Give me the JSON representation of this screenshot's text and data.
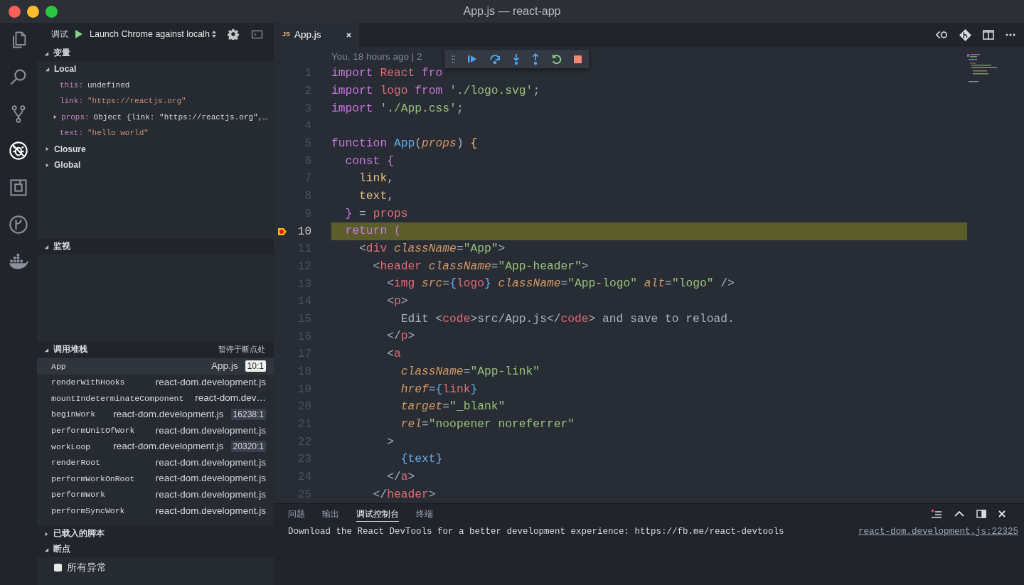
{
  "window": {
    "title": "App.js — react-app"
  },
  "activity_bar": {
    "items": [
      {
        "selected": false
      },
      {
        "selected": false
      },
      {
        "selected": false
      },
      {
        "selected": true
      },
      {
        "selected": false
      },
      {
        "selected": false
      },
      {
        "selected": false
      }
    ]
  },
  "debug_toolbar": {
    "label": "调试",
    "configuration": "Launch Chrome against localh"
  },
  "variables": {
    "title": "变量",
    "expanded": true,
    "scopes": [
      {
        "name": "Local",
        "expanded": true,
        "children": [
          {
            "name": "this:",
            "value": "undefined",
            "kind": "plain"
          },
          {
            "name": "link:",
            "value": "\"https://reactjs.org\"",
            "kind": "string"
          },
          {
            "name": "props:",
            "value": "Object {link: \"https://reactjs.org\",…",
            "kind": "object",
            "expanded": false
          },
          {
            "name": "text:",
            "value": "\"hello world\"",
            "kind": "string"
          }
        ]
      },
      {
        "name": "Closure",
        "expanded": false
      },
      {
        "name": "Global",
        "expanded": false
      }
    ]
  },
  "watch": {
    "title": "监视",
    "expanded": true
  },
  "call_stack": {
    "title": "调用堆栈",
    "expanded": true,
    "status": "暂停于断点处",
    "frames": [
      {
        "name": "App",
        "file": "App.js",
        "line": "10:1",
        "selected": true
      },
      {
        "name": "renderWithHooks",
        "file": "react-dom.development.js",
        "selected": false
      },
      {
        "name": "mountIndeterminateComponent",
        "file": "react-dom.dev…",
        "selected": false
      },
      {
        "name": "beginWork",
        "file": "react-dom.development.js",
        "line": "16238:1",
        "selected": false
      },
      {
        "name": "performUnitOfWork",
        "file": "react-dom.development.js",
        "selected": false
      },
      {
        "name": "workLoop",
        "file": "react-dom.development.js",
        "line": "20320:1",
        "selected": false
      },
      {
        "name": "renderRoot",
        "file": "react-dom.development.js",
        "selected": false
      },
      {
        "name": "performWorkOnRoot",
        "file": "react-dom.development.js",
        "selected": false
      },
      {
        "name": "performWork",
        "file": "react-dom.development.js",
        "selected": false
      },
      {
        "name": "performSyncWork",
        "file": "react-dom.development.js",
        "selected": false
      }
    ]
  },
  "loaded_scripts": {
    "title": "已载入的脚本",
    "expanded": false
  },
  "breakpoints": {
    "title": "断点",
    "expanded": true,
    "items": [
      {
        "label": "所有异常",
        "checked": false
      }
    ]
  },
  "tabs": [
    {
      "icon_label": "JS",
      "label": "App.js",
      "selected": true
    }
  ],
  "blame": "You, 18 hours ago | 2",
  "code": {
    "lines": [
      {
        "number": "1",
        "current": false,
        "breakpoint": false,
        "segments": [
          {
            "kind": "keyword",
            "text": "import "
          },
          {
            "kind": "variable",
            "text": "React "
          },
          {
            "kind": "keyword",
            "text": "fro"
          }
        ]
      },
      {
        "number": "2",
        "current": false,
        "breakpoint": false,
        "segments": [
          {
            "kind": "keyword",
            "text": "import "
          },
          {
            "kind": "variable",
            "text": "logo "
          },
          {
            "kind": "keyword",
            "text": "from "
          },
          {
            "kind": "string",
            "text": "'./logo.svg'"
          },
          {
            "kind": "plain",
            "text": ";"
          }
        ]
      },
      {
        "number": "3",
        "current": false,
        "breakpoint": false,
        "segments": [
          {
            "kind": "keyword",
            "text": "import "
          },
          {
            "kind": "string",
            "text": "'./App.css'"
          },
          {
            "kind": "plain",
            "text": ";"
          }
        ]
      },
      {
        "number": "4",
        "current": false,
        "breakpoint": false
      },
      {
        "number": "5",
        "current": false,
        "breakpoint": false,
        "segments": [
          {
            "kind": "keyword",
            "text": "function "
          },
          {
            "kind": "function",
            "text": "App"
          },
          {
            "kind": "plain",
            "text": "("
          },
          {
            "kind": "parameter",
            "text": "props"
          },
          {
            "kind": "plain",
            "text": ") "
          },
          {
            "kind": "brace",
            "text": "{"
          }
        ]
      },
      {
        "number": "6",
        "current": false,
        "breakpoint": false,
        "segments": [
          {
            "kind": "keyword",
            "text": "  const {"
          }
        ]
      },
      {
        "number": "7",
        "current": false,
        "breakpoint": false,
        "segments": [
          {
            "kind": "brace",
            "text": "    link"
          },
          {
            "kind": "plain",
            "text": ","
          }
        ]
      },
      {
        "number": "8",
        "current": false,
        "breakpoint": false,
        "segments": [
          {
            "kind": "brace",
            "text": "    text"
          },
          {
            "kind": "plain",
            "text": ","
          }
        ]
      },
      {
        "number": "9",
        "current": false,
        "breakpoint": false,
        "segments": [
          {
            "kind": "keyword",
            "text": "  }"
          },
          {
            "kind": "plain",
            "text": " = "
          },
          {
            "kind": "variable",
            "text": "props"
          }
        ]
      },
      {
        "number": "10",
        "current": true,
        "breakpoint": true,
        "segments": [
          {
            "kind": "keyword",
            "text": "  return ("
          }
        ]
      },
      {
        "number": "11",
        "current": false,
        "breakpoint": false,
        "segments": [
          {
            "kind": "plain",
            "text": "    <"
          },
          {
            "kind": "tag",
            "text": "div"
          },
          {
            "kind": "attribute",
            "text": " className"
          },
          {
            "kind": "plain",
            "text": "="
          },
          {
            "kind": "string",
            "text": "\"App\""
          },
          {
            "kind": "plain",
            "text": ">"
          }
        ]
      },
      {
        "number": "12",
        "current": false,
        "breakpoint": false,
        "segments": [
          {
            "kind": "plain",
            "text": "      <"
          },
          {
            "kind": "tag",
            "text": "header"
          },
          {
            "kind": "attribute",
            "text": " className"
          },
          {
            "kind": "plain",
            "text": "="
          },
          {
            "kind": "string",
            "text": "\"App-header\""
          },
          {
            "kind": "plain",
            "text": ">"
          }
        ]
      },
      {
        "number": "13",
        "current": false,
        "breakpoint": false,
        "segments": [
          {
            "kind": "plain",
            "text": "        <"
          },
          {
            "kind": "tag",
            "text": "img"
          },
          {
            "kind": "attribute",
            "text": " src"
          },
          {
            "kind": "plain",
            "text": "="
          },
          {
            "kind": "expression",
            "text": "{"
          },
          {
            "kind": "variable",
            "text": "logo"
          },
          {
            "kind": "expression",
            "text": "}"
          },
          {
            "kind": "attribute",
            "text": " className"
          },
          {
            "kind": "plain",
            "text": "="
          },
          {
            "kind": "string",
            "text": "\"App-logo\""
          },
          {
            "kind": "attribute",
            "text": " alt"
          },
          {
            "kind": "plain",
            "text": "="
          },
          {
            "kind": "string",
            "text": "\"logo\""
          },
          {
            "kind": "plain",
            "text": " />"
          }
        ]
      },
      {
        "number": "14",
        "current": false,
        "breakpoint": false,
        "segments": [
          {
            "kind": "plain",
            "text": "        <"
          },
          {
            "kind": "tag",
            "text": "p"
          },
          {
            "kind": "plain",
            "text": ">"
          }
        ]
      },
      {
        "number": "15",
        "current": false,
        "breakpoint": false,
        "segments": [
          {
            "kind": "plain",
            "text": "          Edit <"
          },
          {
            "kind": "tag",
            "text": "code"
          },
          {
            "kind": "plain",
            "text": ">src/App.js</"
          },
          {
            "kind": "tag",
            "text": "code"
          },
          {
            "kind": "plain",
            "text": "> and save to reload."
          }
        ]
      },
      {
        "number": "16",
        "current": false,
        "breakpoint": false,
        "segments": [
          {
            "kind": "plain",
            "text": "        </"
          },
          {
            "kind": "tag",
            "text": "p"
          },
          {
            "kind": "plain",
            "text": ">"
          }
        ]
      },
      {
        "number": "17",
        "current": false,
        "breakpoint": false,
        "segments": [
          {
            "kind": "plain",
            "text": "        <"
          },
          {
            "kind": "tag",
            "text": "a"
          }
        ]
      },
      {
        "number": "18",
        "current": false,
        "breakpoint": false,
        "segments": [
          {
            "kind": "attribute",
            "text": "          className"
          },
          {
            "kind": "plain",
            "text": "="
          },
          {
            "kind": "string",
            "text": "\"App-link\""
          }
        ]
      },
      {
        "number": "19",
        "current": false,
        "breakpoint": false,
        "segments": [
          {
            "kind": "attribute",
            "text": "          href"
          },
          {
            "kind": "plain",
            "text": "="
          },
          {
            "kind": "expression",
            "text": "{"
          },
          {
            "kind": "variable",
            "text": "link"
          },
          {
            "kind": "expression",
            "text": "}"
          }
        ]
      },
      {
        "number": "20",
        "current": false,
        "breakpoint": false,
        "segments": [
          {
            "kind": "attribute",
            "text": "          target"
          },
          {
            "kind": "plain",
            "text": "="
          },
          {
            "kind": "string",
            "text": "\"_blank\""
          }
        ]
      },
      {
        "number": "21",
        "current": false,
        "breakpoint": false,
        "segments": [
          {
            "kind": "attribute",
            "text": "          rel"
          },
          {
            "kind": "plain",
            "text": "="
          },
          {
            "kind": "string",
            "text": "\"noopener noreferrer\""
          }
        ]
      },
      {
        "number": "22",
        "current": false,
        "breakpoint": false,
        "segments": [
          {
            "kind": "plain",
            "text": "        >"
          }
        ]
      },
      {
        "number": "23",
        "current": false,
        "breakpoint": false,
        "segments": [
          {
            "kind": "expression",
            "text": "          {text}"
          }
        ]
      },
      {
        "number": "24",
        "current": false,
        "breakpoint": false,
        "segments": [
          {
            "kind": "plain",
            "text": "        </"
          },
          {
            "kind": "tag",
            "text": "a"
          },
          {
            "kind": "plain",
            "text": ">"
          }
        ]
      },
      {
        "number": "25",
        "current": false,
        "breakpoint": false,
        "segments": [
          {
            "kind": "plain",
            "text": "      </"
          },
          {
            "kind": "tag",
            "text": "header"
          },
          {
            "kind": "plain",
            "text": ">"
          }
        ]
      }
    ]
  },
  "panel": {
    "tabs": [
      {
        "label": "问题",
        "selected": false
      },
      {
        "label": "输出",
        "selected": false
      },
      {
        "label": "调试控制台",
        "selected": true
      },
      {
        "label": "终端",
        "selected": false
      }
    ],
    "messages": [
      {
        "text": "Download the React DevTools for a better development experience: https://fb.me/react-devtools",
        "source": "react-dom.development.js:22325"
      }
    ]
  }
}
